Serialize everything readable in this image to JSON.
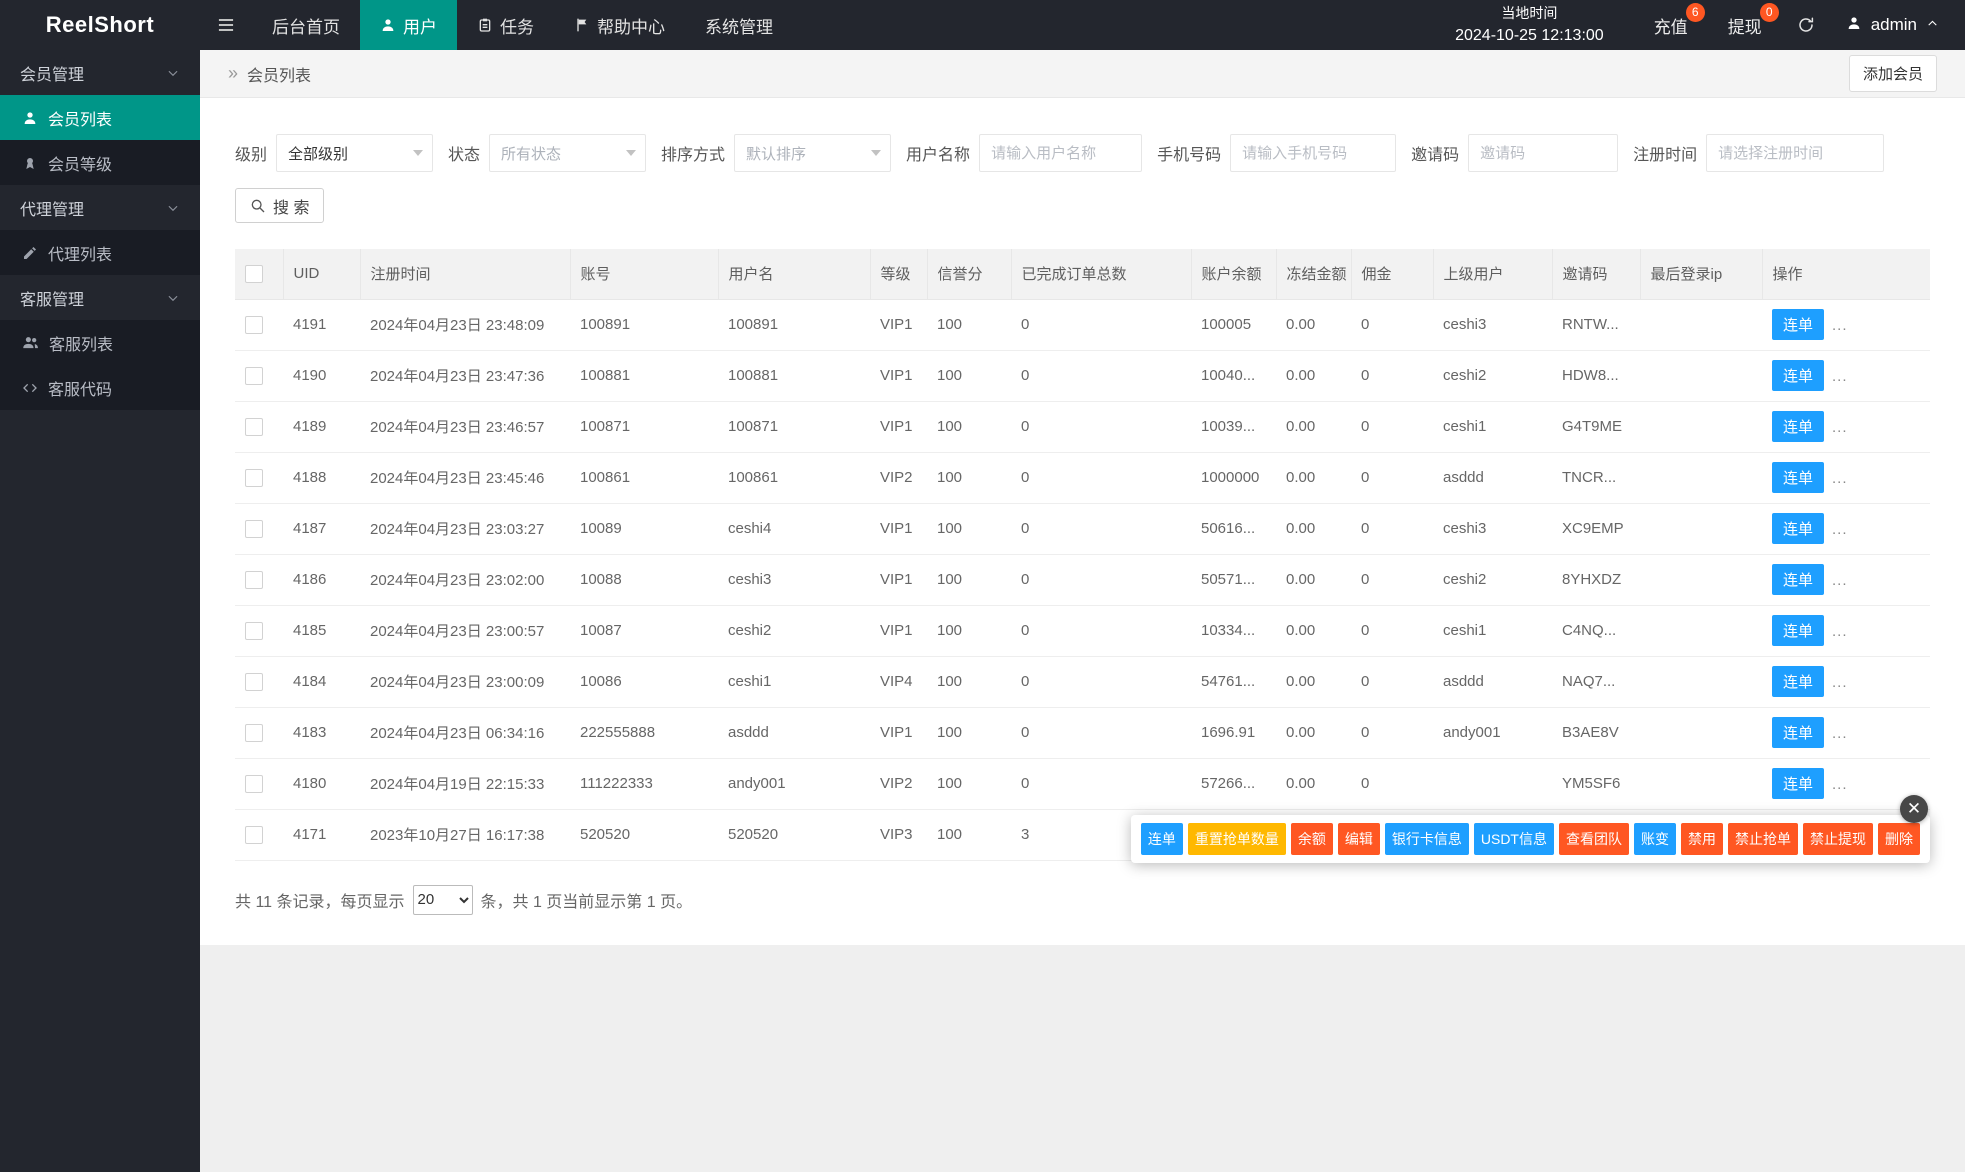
{
  "topbar": {
    "logo": "ReelShort",
    "nav": [
      {
        "key": "home",
        "label": "后台首页",
        "icon": null,
        "active": false
      },
      {
        "key": "users",
        "label": "用户",
        "icon": "user",
        "active": true
      },
      {
        "key": "tasks",
        "label": "任务",
        "icon": "task",
        "active": false
      },
      {
        "key": "help",
        "label": "帮助中心",
        "icon": "flag",
        "active": false
      },
      {
        "key": "system",
        "label": "系统管理",
        "icon": null,
        "active": false
      }
    ],
    "local_time_label": "当地时间",
    "local_time_value": "2024-10-25 12:13:00",
    "quick_links": [
      {
        "key": "recharge",
        "label": "充值",
        "badge": "6"
      },
      {
        "key": "withdraw",
        "label": "提现",
        "badge": "0"
      }
    ],
    "admin_label": "admin"
  },
  "sidebar": {
    "items": [
      {
        "key": "member-management",
        "type": "group",
        "label": "会员管理"
      },
      {
        "key": "member-list",
        "type": "item",
        "label": "会员列表",
        "icon": "user",
        "active": true
      },
      {
        "key": "member-level",
        "type": "item",
        "label": "会员等级",
        "icon": "level",
        "active": false
      },
      {
        "key": "agent-management",
        "type": "group",
        "label": "代理管理"
      },
      {
        "key": "agent-list",
        "type": "item",
        "label": "代理列表",
        "icon": "agent",
        "active": false
      },
      {
        "key": "service-management",
        "type": "group",
        "label": "客服管理"
      },
      {
        "key": "service-list",
        "type": "item",
        "label": "客服列表",
        "icon": "people",
        "active": false
      },
      {
        "key": "service-code",
        "type": "item",
        "label": "客服代码",
        "icon": "code",
        "active": false
      }
    ]
  },
  "page": {
    "breadcrumb_icon": "»",
    "breadcrumb": "会员列表",
    "add_button": "添加会员"
  },
  "filters": {
    "fields": [
      {
        "key": "level",
        "label": "级别",
        "type": "select",
        "value": "全部级别",
        "muted": false
      },
      {
        "key": "status",
        "label": "状态",
        "type": "select",
        "value": "所有状态",
        "muted": true
      },
      {
        "key": "sort",
        "label": "排序方式",
        "type": "select",
        "value": "默认排序",
        "muted": true
      },
      {
        "key": "username",
        "label": "用户名称",
        "type": "input",
        "placeholder": "请输入用户名称"
      },
      {
        "key": "phone",
        "label": "手机号码",
        "type": "input",
        "placeholder": "请输入手机号码"
      },
      {
        "key": "invite_code",
        "label": "邀请码",
        "type": "input",
        "placeholder": "邀请码"
      },
      {
        "key": "reg_time",
        "label": "注册时间",
        "type": "input",
        "placeholder": "请选择注册时间"
      }
    ],
    "search_button": "搜 索"
  },
  "table": {
    "headers": [
      "UID",
      "注册时间",
      "账号",
      "用户名",
      "等级",
      "信誉分",
      "已完成订单总数",
      "账户余额",
      "冻结金额",
      "佣金",
      "上级用户",
      "邀请码",
      "最后登录ip",
      "操作"
    ],
    "row_action": "连单",
    "row_more": "...",
    "rows": [
      {
        "uid": "4191",
        "reg_time": "2024年04月23日 23:48:09",
        "account": "100891",
        "username": "100891",
        "level": "VIP1",
        "credit": "100",
        "orders": "0",
        "balance": "100005",
        "frozen": "0.00",
        "commission": "0",
        "parent": "ceshi3",
        "invite": "RNTW...",
        "last_ip": ""
      },
      {
        "uid": "4190",
        "reg_time": "2024年04月23日 23:47:36",
        "account": "100881",
        "username": "100881",
        "level": "VIP1",
        "credit": "100",
        "orders": "0",
        "balance": "10040...",
        "frozen": "0.00",
        "commission": "0",
        "parent": "ceshi2",
        "invite": "HDW8...",
        "last_ip": ""
      },
      {
        "uid": "4189",
        "reg_time": "2024年04月23日 23:46:57",
        "account": "100871",
        "username": "100871",
        "level": "VIP1",
        "credit": "100",
        "orders": "0",
        "balance": "10039...",
        "frozen": "0.00",
        "commission": "0",
        "parent": "ceshi1",
        "invite": "G4T9ME",
        "last_ip": ""
      },
      {
        "uid": "4188",
        "reg_time": "2024年04月23日 23:45:46",
        "account": "100861",
        "username": "100861",
        "level": "VIP2",
        "credit": "100",
        "orders": "0",
        "balance": "1000000",
        "frozen": "0.00",
        "commission": "0",
        "parent": "asddd",
        "invite": "TNCR...",
        "last_ip": ""
      },
      {
        "uid": "4187",
        "reg_time": "2024年04月23日 23:03:27",
        "account": "10089",
        "username": "ceshi4",
        "level": "VIP1",
        "credit": "100",
        "orders": "0",
        "balance": "50616...",
        "frozen": "0.00",
        "commission": "0",
        "parent": "ceshi3",
        "invite": "XC9EMP",
        "last_ip": ""
      },
      {
        "uid": "4186",
        "reg_time": "2024年04月23日 23:02:00",
        "account": "10088",
        "username": "ceshi3",
        "level": "VIP1",
        "credit": "100",
        "orders": "0",
        "balance": "50571...",
        "frozen": "0.00",
        "commission": "0",
        "parent": "ceshi2",
        "invite": "8YHXDZ",
        "last_ip": ""
      },
      {
        "uid": "4185",
        "reg_time": "2024年04月23日 23:00:57",
        "account": "10087",
        "username": "ceshi2",
        "level": "VIP1",
        "credit": "100",
        "orders": "0",
        "balance": "10334...",
        "frozen": "0.00",
        "commission": "0",
        "parent": "ceshi1",
        "invite": "C4NQ...",
        "last_ip": ""
      },
      {
        "uid": "4184",
        "reg_time": "2024年04月23日 23:00:09",
        "account": "10086",
        "username": "ceshi1",
        "level": "VIP4",
        "credit": "100",
        "orders": "0",
        "balance": "54761...",
        "frozen": "0.00",
        "commission": "0",
        "parent": "asddd",
        "invite": "NAQ7...",
        "last_ip": ""
      },
      {
        "uid": "4183",
        "reg_time": "2024年04月23日 06:34:16",
        "account": "222555888",
        "username": "asddd",
        "level": "VIP1",
        "credit": "100",
        "orders": "0",
        "balance": "1696.91",
        "frozen": "0.00",
        "commission": "0",
        "parent": "andy001",
        "invite": "B3AE8V",
        "last_ip": ""
      },
      {
        "uid": "4180",
        "reg_time": "2024年04月19日 22:15:33",
        "account": "111222333",
        "username": "andy001",
        "level": "VIP2",
        "credit": "100",
        "orders": "0",
        "balance": "57266...",
        "frozen": "0.00",
        "commission": "0",
        "parent": "",
        "invite": "YM5SF6",
        "last_ip": ""
      },
      {
        "uid": "4171",
        "reg_time": "2023年10月27日 16:17:38",
        "account": "520520",
        "username": "520520",
        "level": "VIP3",
        "credit": "100",
        "orders": "3",
        "balance": "",
        "frozen": "",
        "commission": "",
        "parent": "",
        "invite": "",
        "last_ip": ""
      }
    ]
  },
  "action_popup": {
    "close_glyph": "✕",
    "buttons": [
      {
        "key": "chain-order",
        "label": "连单",
        "color": "#1E9FFF"
      },
      {
        "key": "reset-grab-count",
        "label": "重置抢单数量",
        "color": "#FFB800"
      },
      {
        "key": "balance",
        "label": "余额",
        "color": "#FF5722"
      },
      {
        "key": "edit",
        "label": "编辑",
        "color": "#FF5722"
      },
      {
        "key": "bank-card-info",
        "label": "银行卡信息",
        "color": "#1E9FFF"
      },
      {
        "key": "usdt-info",
        "label": "USDT信息",
        "color": "#1E9FFF"
      },
      {
        "key": "view-team",
        "label": "查看团队",
        "color": "#FF5722"
      },
      {
        "key": "balance-change",
        "label": "账变",
        "color": "#1E9FFF"
      },
      {
        "key": "disable",
        "label": "禁用",
        "color": "#FF5722"
      },
      {
        "key": "forbid-grab",
        "label": "禁止抢单",
        "color": "#FF5722"
      },
      {
        "key": "forbid-withdraw",
        "label": "禁止提现",
        "color": "#FF5722"
      },
      {
        "key": "delete",
        "label": "删除",
        "color": "#FF5722"
      }
    ]
  },
  "pagination": {
    "prefix": "共 11 条记录，每页显示",
    "page_size": "20",
    "suffix": "条，共 1 页当前显示第 1 页。"
  },
  "colors": {
    "accent": "#009688",
    "primary": "#1E9FFF",
    "warning": "#FFB800",
    "danger": "#FF5722",
    "topbar_bg": "#23262E",
    "sidebar_sub_bg": "#191C24"
  }
}
